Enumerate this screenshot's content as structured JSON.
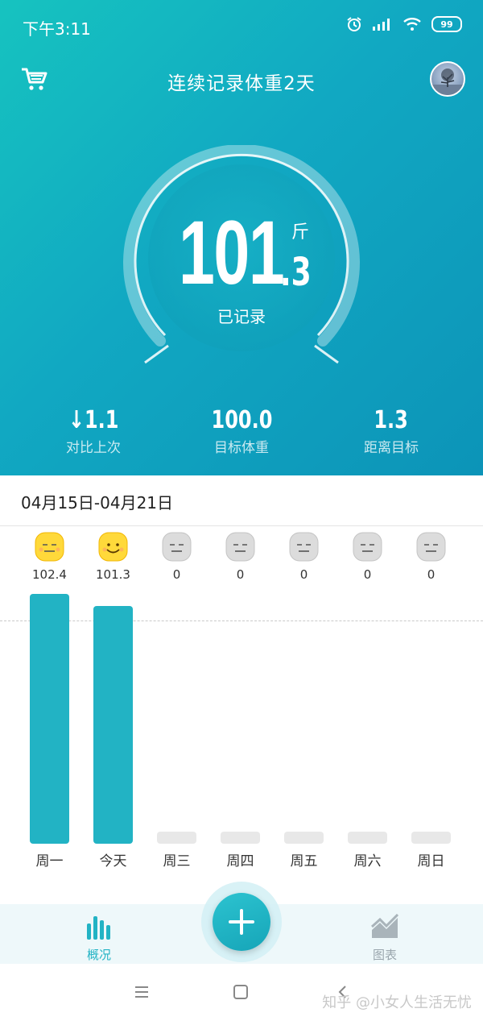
{
  "status": {
    "time": "下午3:11",
    "battery": "99"
  },
  "header": {
    "title": "连续记录体重2天"
  },
  "current": {
    "integer": "101",
    "decimal": ".3",
    "unit": "斤",
    "state_label": "已记录"
  },
  "stats": [
    {
      "value": "↓1.1",
      "label": "对比上次"
    },
    {
      "value": "100.0",
      "label": "目标体重"
    },
    {
      "value": "1.3",
      "label": "距离目标"
    }
  ],
  "week": {
    "range": "04月15日-04月21日"
  },
  "days": [
    {
      "label": "周一",
      "value_text": "102.4",
      "value": 102.4,
      "face": "yellow-neutral"
    },
    {
      "label": "今天",
      "value_text": "101.3",
      "value": 101.3,
      "face": "yellow-smile"
    },
    {
      "label": "周三",
      "value_text": "0",
      "value": 0,
      "face": "gray-neutral"
    },
    {
      "label": "周四",
      "value_text": "0",
      "value": 0,
      "face": "gray-neutral"
    },
    {
      "label": "周五",
      "value_text": "0",
      "value": 0,
      "face": "gray-neutral"
    },
    {
      "label": "周六",
      "value_text": "0",
      "value": 0,
      "face": "gray-neutral"
    },
    {
      "label": "周日",
      "value_text": "0",
      "value": 0,
      "face": "gray-neutral"
    }
  ],
  "chart_data": {
    "type": "bar",
    "categories": [
      "周一",
      "今天",
      "周三",
      "周四",
      "周五",
      "周六",
      "周日"
    ],
    "values": [
      102.4,
      101.3,
      0,
      0,
      0,
      0,
      0
    ],
    "goal": 100.0
  },
  "tabs": [
    {
      "label": "概况",
      "active": true
    },
    {
      "label": "图表",
      "active": false
    }
  ],
  "watermark": "知乎 @小女人生活无忧",
  "colors": {
    "accent": "#22b3c4",
    "hero_start": "#16c3c0",
    "hero_end": "#0c94b8",
    "inactive_tab": "#9aa6ad"
  }
}
